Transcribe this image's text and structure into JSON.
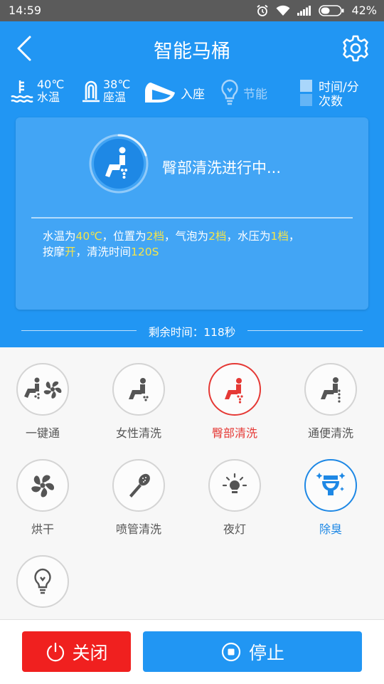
{
  "status_bar": {
    "time": "14:59",
    "battery": "42%"
  },
  "header": {
    "title": "智能马桶"
  },
  "status_row": {
    "water_temp_value": "40℃",
    "water_temp_label": "水温",
    "seat_temp_value": "38℃",
    "seat_temp_label": "座温",
    "seated_label": "入座",
    "energy_label": "节能",
    "mode_time": "时间/分",
    "mode_count": "次数"
  },
  "card": {
    "status": "臀部清洗进行中...",
    "details": {
      "p1": "水温为",
      "water_temp": "40℃",
      "p2": "，位置为",
      "position": "2档",
      "p3": "，气泡为",
      "bubble": "2档",
      "p4": "，水压为",
      "pressure": "1档",
      "p5": "，",
      "p6": "按摩",
      "massage": "开",
      "p7": "，清洗时间",
      "wash_time": "120S"
    }
  },
  "remaining": {
    "text": "剩余时间：118秒"
  },
  "functions": [
    {
      "label": "一键通"
    },
    {
      "label": "女性清洗"
    },
    {
      "label": "臀部清洗"
    },
    {
      "label": "通便清洗"
    },
    {
      "label": "烘干"
    },
    {
      "label": "喷管清洗"
    },
    {
      "label": "夜灯"
    },
    {
      "label": "除臭"
    },
    {
      "label": "节能"
    }
  ],
  "buttons": {
    "close": "关闭",
    "stop": "停止"
  },
  "colors": {
    "primary": "#2196f3",
    "danger": "#f0201f",
    "highlight": "#f4e44a"
  }
}
